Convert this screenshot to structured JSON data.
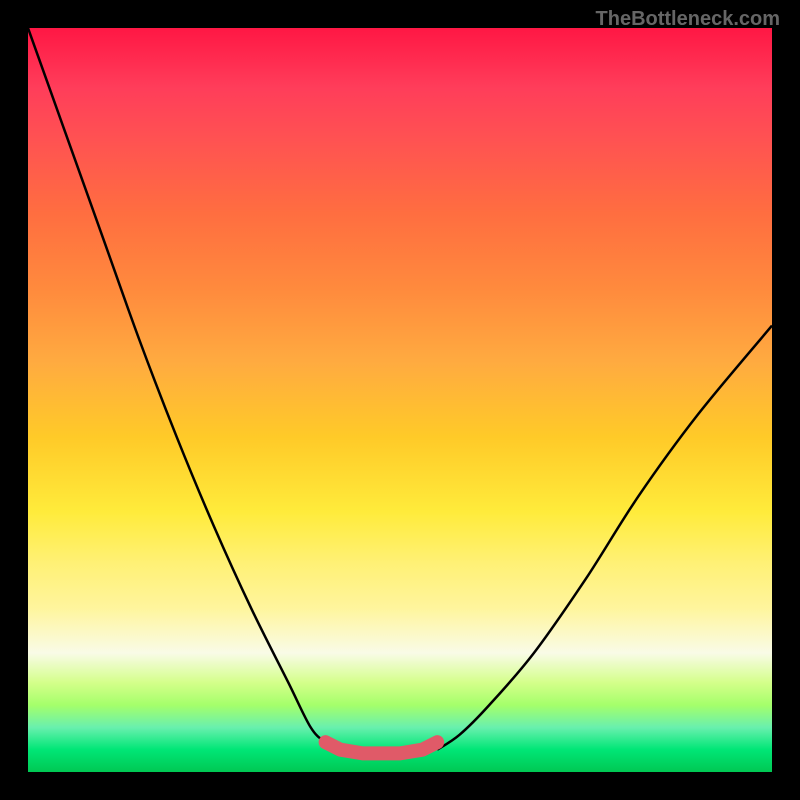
{
  "watermark": "TheBottleneck.com",
  "chart_data": {
    "type": "line",
    "title": "",
    "xlabel": "",
    "ylabel": "",
    "xlim": [
      0,
      100
    ],
    "ylim": [
      0,
      100
    ],
    "series": [
      {
        "name": "left-curve",
        "x": [
          0,
          5,
          10,
          15,
          20,
          25,
          30,
          35,
          38,
          40,
          42
        ],
        "values": [
          100,
          86,
          72,
          58,
          45,
          33,
          22,
          12,
          6,
          4,
          3
        ]
      },
      {
        "name": "right-curve",
        "x": [
          55,
          58,
          62,
          68,
          75,
          82,
          90,
          100
        ],
        "values": [
          3,
          5,
          9,
          16,
          26,
          37,
          48,
          60
        ]
      },
      {
        "name": "bottom-segment",
        "x": [
          40,
          42,
          45,
          50,
          53,
          55
        ],
        "values": [
          4,
          3,
          2.5,
          2.5,
          3,
          4
        ],
        "color": "#e74c5c"
      }
    ],
    "background_gradient": {
      "top": "#ff1744",
      "middle": "#ffeb3b",
      "bottom": "#00c853"
    }
  }
}
